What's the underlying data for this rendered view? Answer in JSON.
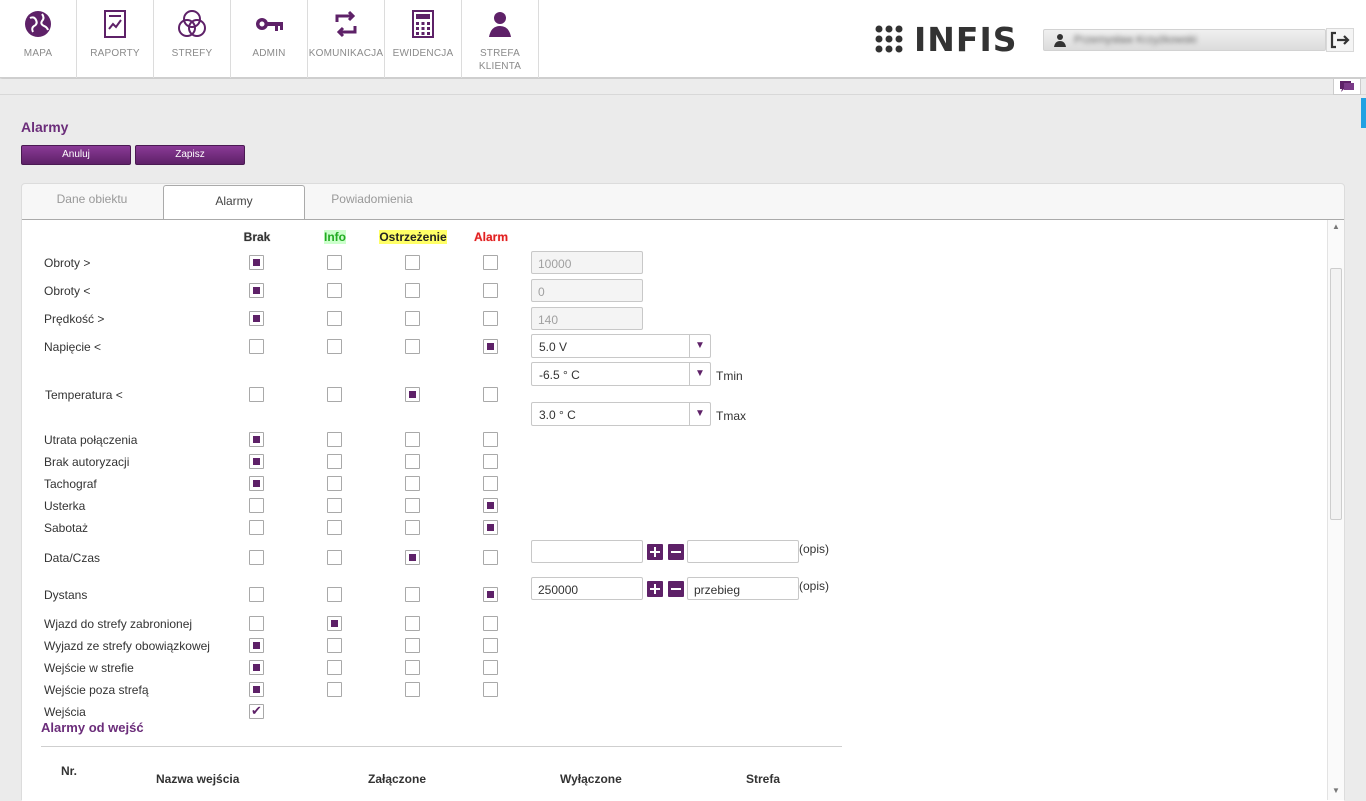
{
  "nav": {
    "items": [
      {
        "label": "MAPA",
        "icon": "globe-icon"
      },
      {
        "label": "RAPORTY",
        "icon": "report-icon"
      },
      {
        "label": "STREFY",
        "icon": "zones-icon"
      },
      {
        "label": "ADMIN",
        "icon": "key-icon"
      },
      {
        "label": "KOMUNIKACJA",
        "icon": "sync-icon"
      },
      {
        "label": "EWIDENCJA",
        "icon": "calculator-icon"
      },
      {
        "label": "STREFA\nKLIENTA",
        "icon": "user-icon"
      }
    ]
  },
  "brand": {
    "name": "INFIS",
    "accent": "#5e2168"
  },
  "user": {
    "name": "Przemysław Krzyżkowski"
  },
  "page": {
    "title": "Alarmy",
    "cancel_label": "Anuluj",
    "save_label": "Zapisz"
  },
  "tabs": [
    {
      "label": "Dane obiektu"
    },
    {
      "label": "Alarmy",
      "active": true
    },
    {
      "label": "Powiadomienia"
    }
  ],
  "levels": {
    "brak": {
      "label": "Brak",
      "color": "#333333"
    },
    "info": {
      "label": "Info",
      "color": "#2c9e2c"
    },
    "ostrzezenie": {
      "label": "Ostrzeżenie",
      "color": "#222222",
      "highlight": "#ffff66"
    },
    "alarm": {
      "label": "Alarm",
      "color": "#e02020"
    }
  },
  "rows": {
    "obroty_gt": {
      "label": "Obroty >",
      "value": "10000",
      "level": "brak"
    },
    "obroty_lt": {
      "label": "Obroty <",
      "value": "0",
      "level": "brak"
    },
    "predkosc": {
      "label": "Prędkość >",
      "value": "140",
      "level": "brak"
    },
    "napiecie": {
      "label": "Napięcie <",
      "value": "5.0 V",
      "level": "alarm"
    },
    "temperatura": {
      "label": "Temperatura <",
      "tmin_value": "-6.5 ° C",
      "tmin_label": "Tmin",
      "tmax_value": "3.0 ° C",
      "tmax_label": "Tmax",
      "level": "ostrzezenie"
    },
    "utrata": {
      "label": "Utrata połączenia",
      "level": "brak"
    },
    "autoryzacja": {
      "label": "Brak autoryzacji",
      "level": "brak"
    },
    "tachograf": {
      "label": "Tachograf",
      "level": "brak"
    },
    "usterka": {
      "label": "Usterka",
      "level": "alarm"
    },
    "sabotaz": {
      "label": "Sabotaż",
      "level": "alarm"
    },
    "dataczas": {
      "label": "Data/Czas",
      "value": "",
      "opis_value": "",
      "opis_label": "(opis)",
      "level": "ostrzezenie"
    },
    "dystans": {
      "label": "Dystans",
      "value": "250000",
      "opis_value": "przebieg",
      "opis_label": "(opis)",
      "level": "alarm"
    },
    "wjazd": {
      "label": "Wjazd do strefy zabronionej",
      "level": "info"
    },
    "wyjazd": {
      "label": "Wyjazd ze strefy obowiązkowej",
      "level": "brak"
    },
    "wejscie_w": {
      "label": "Wejście w strefie",
      "level": "brak"
    },
    "wejscie_poza": {
      "label": "Wejście poza strefą",
      "level": "brak"
    },
    "wejscia": {
      "label": "Wejścia",
      "checked": true
    }
  },
  "inputs_section": {
    "title": "Alarmy od wejść",
    "columns": [
      "Nr.",
      "Nazwa wejścia",
      "Załączone",
      "Wyłączone",
      "Strefa"
    ]
  }
}
